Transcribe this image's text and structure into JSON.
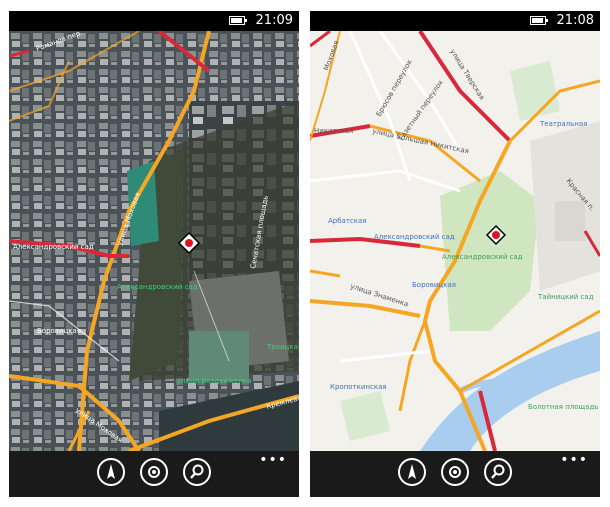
{
  "left_phone": {
    "status": {
      "time": "21:09"
    },
    "labels": {
      "street_mokhovaya_1": "улица Моховая",
      "street_mokhovaya_2": "улица Моховая",
      "street_vozdvizhenka": "улица Воздвиженка",
      "aleksandrovsky_sad_1": "Александровский сад",
      "aleksandrovsky_sad_2": "Александровский сад",
      "borovitskaya": "Боровицкая",
      "troitskaya": "Троицкая",
      "kremlin_emb": "Кремлевская",
      "top_street": "Романов пер.",
      "senate": "Сенатская площадь"
    },
    "app_bar": {
      "more": "•••"
    }
  },
  "right_phone": {
    "status": {
      "time": "21:08"
    },
    "labels": {
      "nikitskaya": "Никитская",
      "bolshaya_nikitskaya": "улица Большая Никитская",
      "tverskaya": "улица Тверская",
      "teatralnaya": "Театральная",
      "gazetny": "Газетный переулок",
      "bryusov": "Брюсов переулок",
      "arbatskaya": "Арбатская",
      "aleksandrovsky_sad": "Александровский сад",
      "aleksandrovsky_sad_park": "Александровский сад",
      "borovitskaya": "Боровицкая",
      "znamenka": "улица Знаменка",
      "kropotkinskaya": "Кропоткинская",
      "tainitsky": "Тайницкий сад",
      "krasnaya": "Красная п.",
      "bolotnaya": "Болотная площадь",
      "mokhovaya_top": "Моховая"
    },
    "app_bar": {
      "more": "•••"
    }
  },
  "colors": {
    "road_orange": "#f5a623",
    "road_red": "#d9283a",
    "park_green": "#cfe6c0",
    "river_blue": "#a9cdee",
    "map_bg": "#f2f1ec"
  },
  "icons": [
    "battery-icon",
    "compass-icon",
    "locate-icon",
    "search-icon",
    "location-marker-icon"
  ]
}
